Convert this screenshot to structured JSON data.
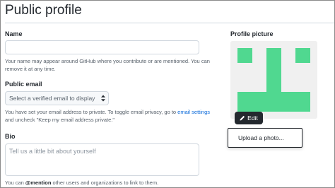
{
  "page": {
    "title": "Public profile"
  },
  "name_field": {
    "label": "Name",
    "value": "",
    "placeholder": "",
    "note": "Your name may appear around GitHub where you contribute or are mentioned. You can remove it at any time."
  },
  "email_field": {
    "label": "Public email",
    "selected": "Select a verified email to display",
    "note_prefix": "You have set your email address to private. To toggle email privacy, go to ",
    "note_link": "email settings",
    "note_suffix": " and uncheck \"Keep my email address private.\""
  },
  "bio_field": {
    "label": "Bio",
    "value": "",
    "placeholder": "Tell us a little bit about yourself",
    "note_prefix": "You can ",
    "note_mention": "@mention",
    "note_suffix": " other users and organizations to link to them."
  },
  "profile_picture": {
    "label": "Profile picture",
    "edit_label": "Edit",
    "menu_items": [
      "Upload a photo..."
    ],
    "avatar_color": "#50d890",
    "avatar_bg": "#f0f0f0"
  },
  "icons": {
    "edit": "pencil-icon",
    "select": "select-arrows-icon"
  }
}
